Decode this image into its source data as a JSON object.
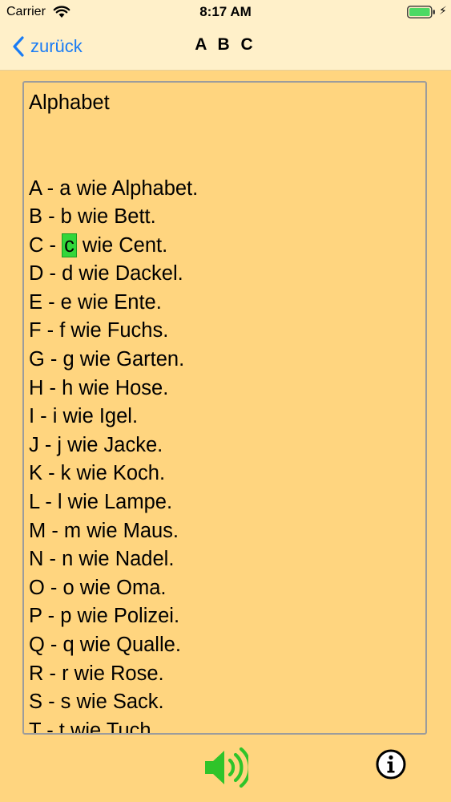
{
  "status_bar": {
    "carrier": "Carrier",
    "time": "8:17 AM"
  },
  "nav": {
    "back_label": "zurück",
    "title": "A B C"
  },
  "content": {
    "heading": "Alphabet",
    "lines": [
      {
        "prefix": "A - ",
        "highlight": "",
        "rest": "a wie Alphabet."
      },
      {
        "prefix": "B - ",
        "highlight": "",
        "rest": "b wie Bett."
      },
      {
        "prefix": "C - ",
        "highlight": "c",
        "rest": " wie Cent."
      },
      {
        "prefix": "D - ",
        "highlight": "",
        "rest": "d wie Dackel."
      },
      {
        "prefix": "E - ",
        "highlight": "",
        "rest": "e wie Ente."
      },
      {
        "prefix": "F - ",
        "highlight": "",
        "rest": "f wie Fuchs."
      },
      {
        "prefix": "G - ",
        "highlight": "",
        "rest": "g wie Garten."
      },
      {
        "prefix": "H - ",
        "highlight": "",
        "rest": "h wie Hose."
      },
      {
        "prefix": "I - ",
        "highlight": "",
        "rest": "i wie Igel."
      },
      {
        "prefix": "J - ",
        "highlight": "",
        "rest": "j wie Jacke."
      },
      {
        "prefix": "K - ",
        "highlight": "",
        "rest": "k wie Koch."
      },
      {
        "prefix": "L - ",
        "highlight": "",
        "rest": "l wie Lampe."
      },
      {
        "prefix": "M - ",
        "highlight": "",
        "rest": "m wie Maus."
      },
      {
        "prefix": "N - ",
        "highlight": "",
        "rest": "n wie Nadel."
      },
      {
        "prefix": "O - ",
        "highlight": "",
        "rest": "o wie Oma."
      },
      {
        "prefix": "P - ",
        "highlight": "",
        "rest": "p wie Polizei."
      },
      {
        "prefix": "Q - ",
        "highlight": "",
        "rest": "q wie Qualle."
      },
      {
        "prefix": "R - ",
        "highlight": "",
        "rest": "r wie Rose."
      },
      {
        "prefix": "S - ",
        "highlight": "",
        "rest": "s wie Sack."
      },
      {
        "prefix": "T - ",
        "highlight": "",
        "rest": "t wie Tuch."
      }
    ]
  },
  "toolbar": {
    "sound_icon": "speaker-icon",
    "info_icon": "info-icon"
  },
  "colors": {
    "background": "#ffd57f",
    "bar": "#fff0c9",
    "accent": "#1a7cf5",
    "highlight": "#33d63a",
    "sound": "#2fc42a"
  }
}
